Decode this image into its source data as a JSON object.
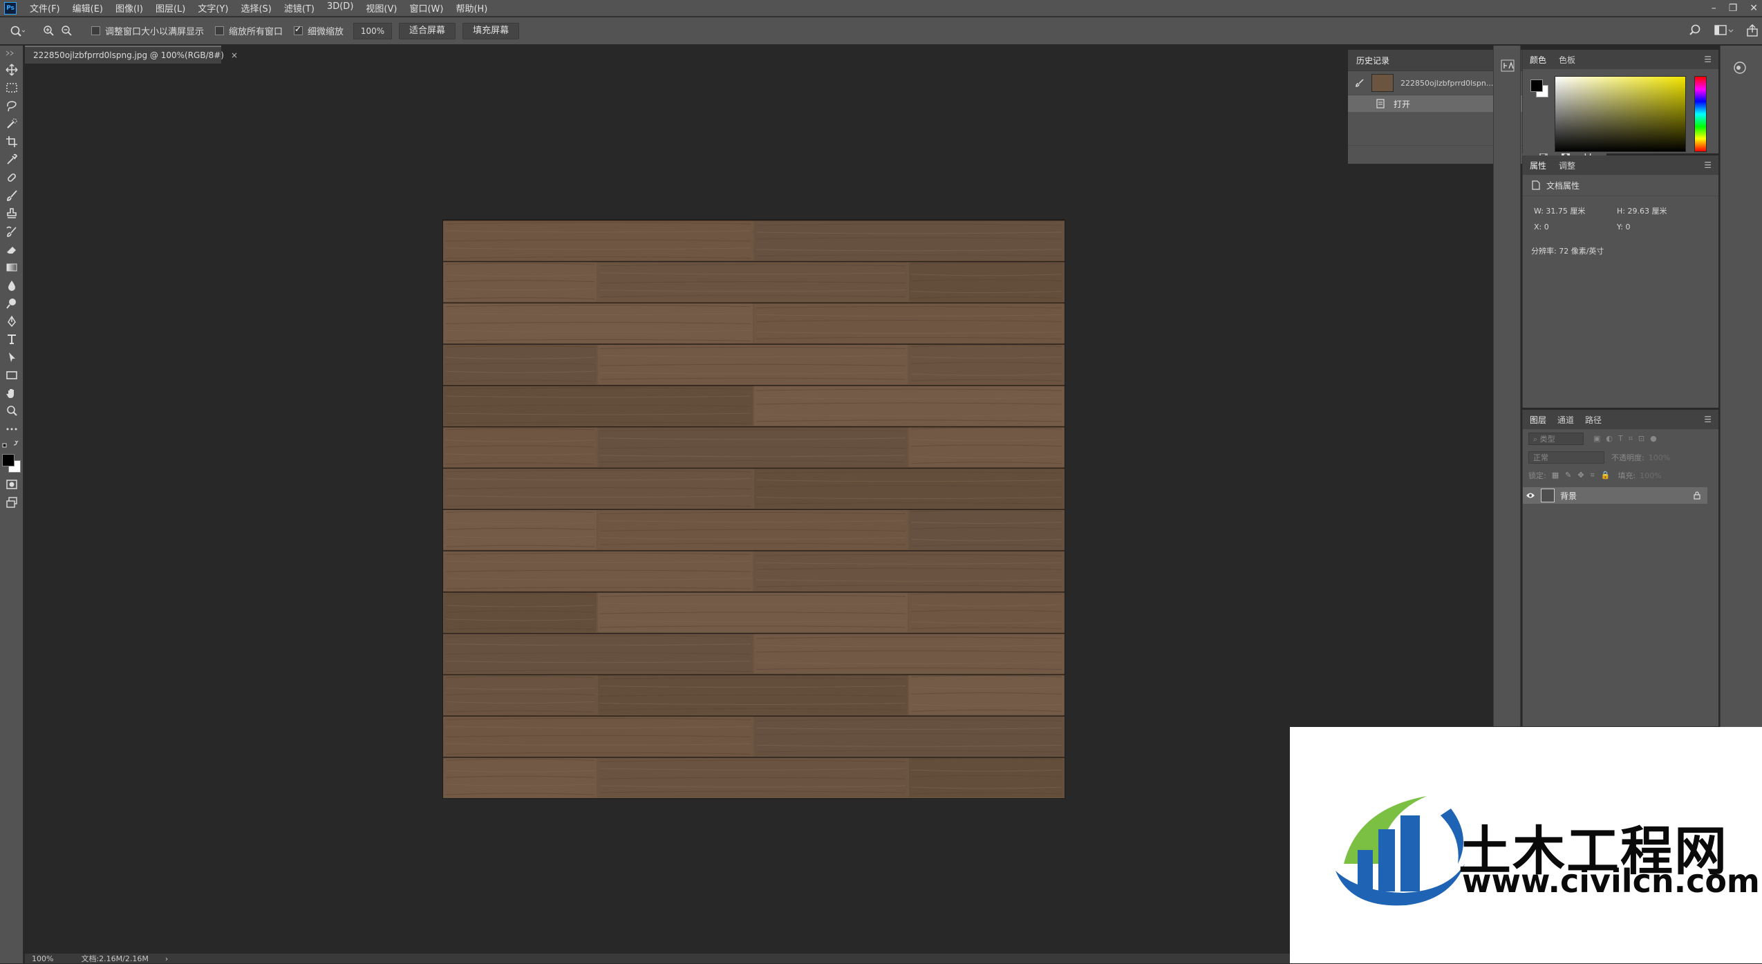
{
  "app": {
    "logo": "Ps"
  },
  "menu": [
    "文件(F)",
    "编辑(E)",
    "图像(I)",
    "图层(L)",
    "文字(Y)",
    "选择(S)",
    "滤镜(T)",
    "3D(D)",
    "视图(V)",
    "窗口(W)",
    "帮助(H)"
  ],
  "options": {
    "resize_windows": {
      "label": "调整窗口大小以满屏显示",
      "checked": false
    },
    "zoom_all_windows": {
      "label": "缩放所有窗口",
      "checked": false
    },
    "scrubby_zoom": {
      "label": "细微缩放",
      "checked": true
    },
    "zoom_value": "100%",
    "fit_screen": "适合屏幕",
    "fill_screen": "填充屏幕"
  },
  "document": {
    "tab_title": "222850ojlzbfprrd0lspng.jpg @ 100%(RGB/8#)",
    "close": "×"
  },
  "history_panel": {
    "tab": "历史记录",
    "snapshot_name": "222850ojlzbfprrd0lspn...",
    "items": [
      "打开"
    ]
  },
  "color_panel": {
    "tabs": [
      "颜色",
      "色板"
    ]
  },
  "properties_panel": {
    "tabs": [
      "属性",
      "调整"
    ],
    "section": "文档属性",
    "w": "W:  31.75 厘米",
    "h": "H:  29.63 厘米",
    "x": "X:  0",
    "y": "Y:  0",
    "resolution": "分辨率: 72 像素/英寸"
  },
  "layers_panel": {
    "tabs": [
      "图层",
      "通道",
      "路径"
    ],
    "filter_placeholder": "类型",
    "blend_mode": "正常",
    "opacity_label": "不透明度:",
    "opacity_value": "100%",
    "lock_label": "锁定:",
    "fill_label": "填充:",
    "fill_value": "100%",
    "layer_name": "背景"
  },
  "status": {
    "zoom": "100%",
    "doc_size": "文档:2.16M/2.16M"
  },
  "watermark": {
    "title": "土木工程网",
    "url": "www.civilcn.com"
  },
  "colors": {
    "ui_panel": "#535353",
    "ui_dark": "#282828",
    "wood": "#6b5440",
    "wm_blue": "#1f64b4",
    "wm_green": "#7cc043"
  }
}
